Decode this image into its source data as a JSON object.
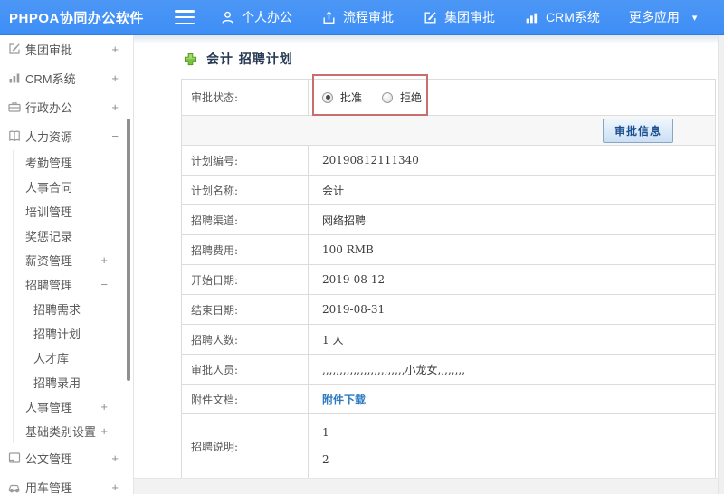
{
  "colors": {
    "header_blue": "#3e8ef7",
    "link_blue": "#2d7ac0",
    "annotation_red": "#c76e6e",
    "button_text_blue": "#1c4f8f",
    "title_navy": "#2a3c55"
  },
  "header": {
    "logo": "PHPOA协同办公软件",
    "nav": [
      {
        "label": "个人办公",
        "icon": "user-icon"
      },
      {
        "label": "流程审批",
        "icon": "workflow-upload-icon"
      },
      {
        "label": "集团审批",
        "icon": "edit-icon"
      },
      {
        "label": "CRM系统",
        "icon": "bar-chart-icon"
      },
      {
        "label": "更多应用",
        "icon": "caret-down-icon"
      }
    ],
    "caret": "▾"
  },
  "sidebar": {
    "items": [
      {
        "label": "集团审批",
        "icon": "edit-icon",
        "expand": "+",
        "level": 1
      },
      {
        "label": "CRM系统",
        "icon": "bar-chart-icon",
        "expand": "+",
        "level": 1
      },
      {
        "label": "行政办公",
        "icon": "briefcase-icon",
        "expand": "+",
        "level": 1
      },
      {
        "label": "人力资源",
        "icon": "book-icon",
        "expand": "−",
        "level": 1
      },
      {
        "label": "考勤管理",
        "level": 2
      },
      {
        "label": "人事合同",
        "level": 2
      },
      {
        "label": "培训管理",
        "level": 2
      },
      {
        "label": "奖惩记录",
        "level": 2
      },
      {
        "label": "薪资管理",
        "expand": "+",
        "level": 2
      },
      {
        "label": "招聘管理",
        "expand": "−",
        "level": 2
      },
      {
        "label": "招聘需求",
        "level": 3
      },
      {
        "label": "招聘计划",
        "level": 3
      },
      {
        "label": "人才库",
        "level": 3
      },
      {
        "label": "招聘录用",
        "level": 3
      },
      {
        "label": "人事管理",
        "expand": "+",
        "level": 2
      },
      {
        "label": "基础类别设置",
        "expand": "+",
        "level": 2
      },
      {
        "label": "公文管理",
        "icon": "document-icon",
        "expand": "+",
        "level": 1
      },
      {
        "label": "用车管理",
        "icon": "car-icon",
        "expand": "+",
        "level": 1
      }
    ]
  },
  "main": {
    "title": "会计 招聘计划",
    "form": {
      "status_label": "审批状态:",
      "radio_approve": "批准",
      "radio_reject": "拒绝",
      "radio_selected": "批准",
      "submit_button": "审批信息",
      "rows": [
        {
          "label": "计划编号:",
          "value": "20190812111340"
        },
        {
          "label": "计划名称:",
          "value": "会计"
        },
        {
          "label": "招聘渠道:",
          "value": "网络招聘"
        },
        {
          "label": "招聘费用:",
          "value": "100 RMB"
        },
        {
          "label": "开始日期:",
          "value": "2019-08-12"
        },
        {
          "label": "结束日期:",
          "value": "2019-08-31"
        },
        {
          "label": "招聘人数:",
          "value": "1 人"
        },
        {
          "label": "审批人员:",
          "value": ",,,,,,,,,,,,,,,,,,,,,,,,小龙女,,,,,,,,"
        },
        {
          "label": "附件文档:",
          "value": "附件下载"
        },
        {
          "label": "招聘说明:",
          "lines": [
            "1",
            "2"
          ]
        }
      ]
    }
  }
}
